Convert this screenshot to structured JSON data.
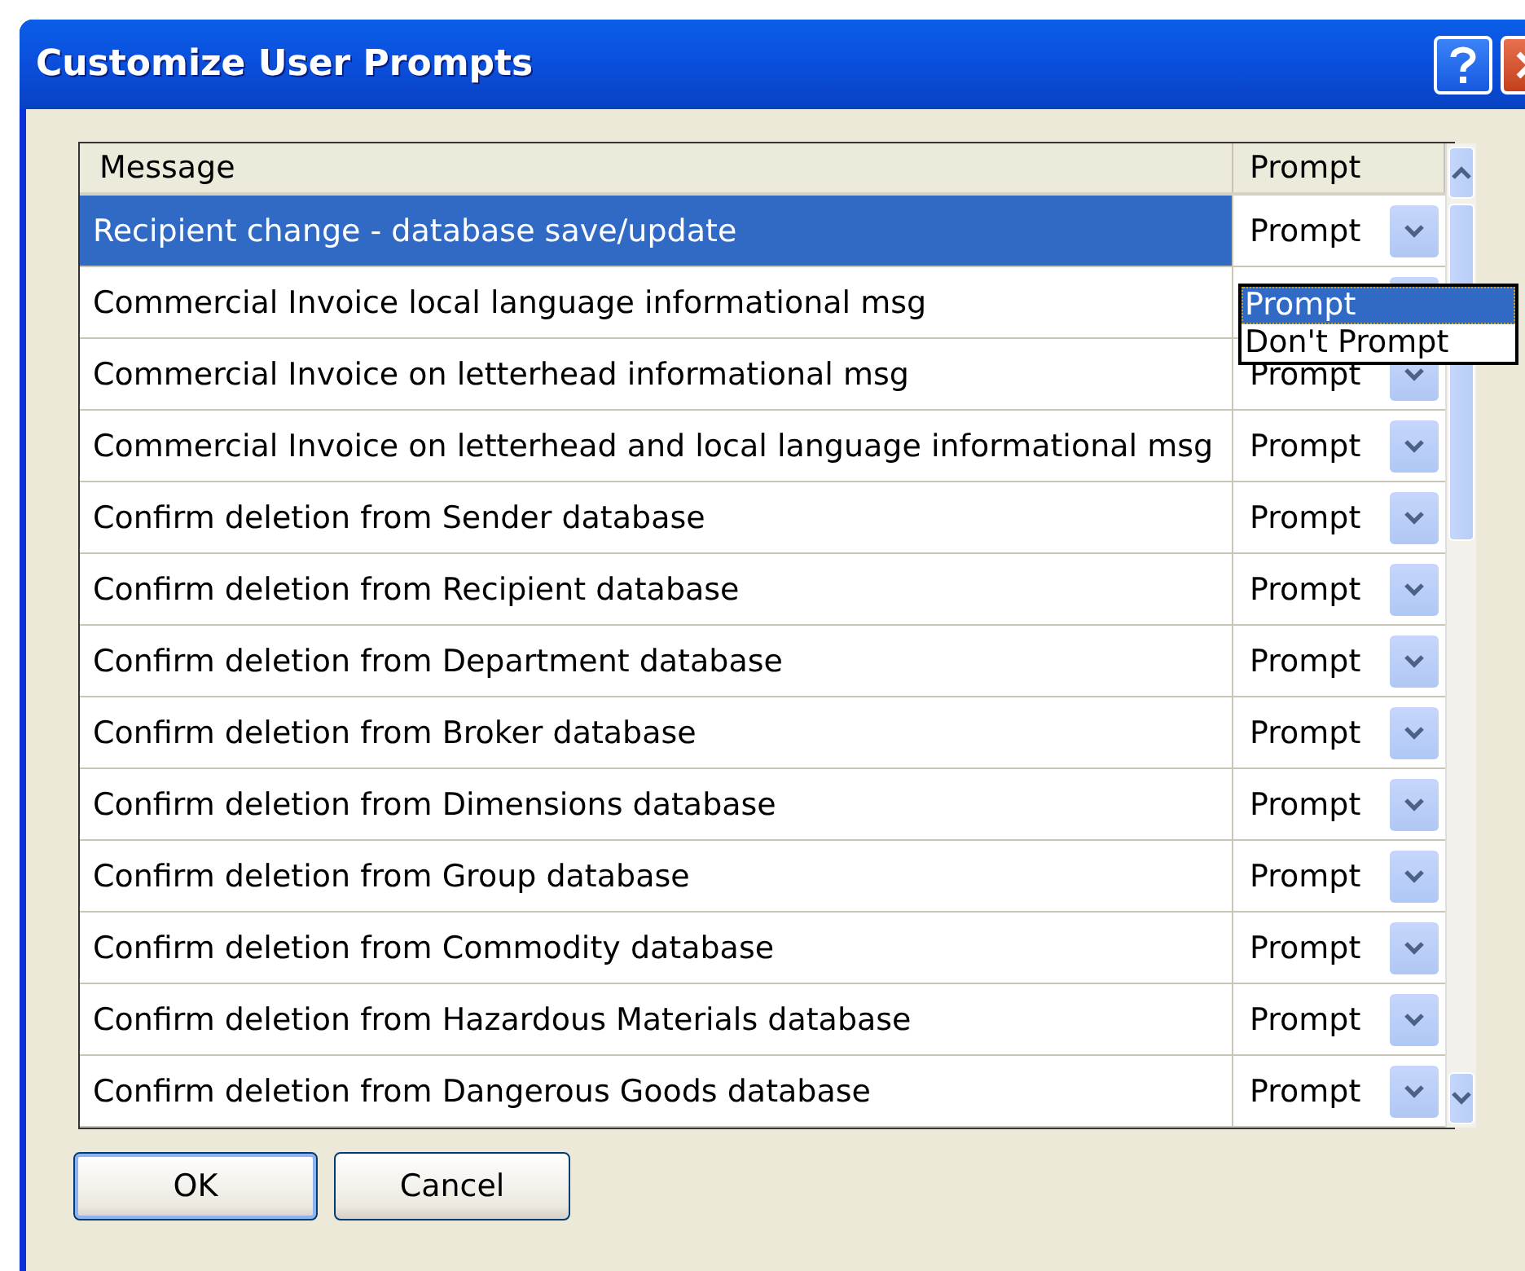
{
  "window": {
    "title": "Customize User Prompts"
  },
  "table": {
    "columns": [
      "Message",
      "Prompt"
    ],
    "rows": [
      {
        "message": "Recipient change - database save/update",
        "prompt": "Prompt",
        "selected": true
      },
      {
        "message": "Commercial Invoice local language informational msg",
        "selected": false
      },
      {
        "message": "Commercial Invoice on letterhead informational msg",
        "prompt": "Prompt",
        "selected": false
      },
      {
        "message": "Commercial Invoice on letterhead and local language informational msg",
        "prompt": "Prompt",
        "selected": false
      },
      {
        "message": "Confirm deletion from Sender database",
        "prompt": "Prompt",
        "selected": false
      },
      {
        "message": "Confirm deletion from Recipient database",
        "prompt": "Prompt",
        "selected": false
      },
      {
        "message": "Confirm deletion from Department database",
        "prompt": "Prompt",
        "selected": false
      },
      {
        "message": "Confirm deletion from Broker database",
        "prompt": "Prompt",
        "selected": false
      },
      {
        "message": "Confirm deletion from Dimensions database",
        "prompt": "Prompt",
        "selected": false
      },
      {
        "message": "Confirm deletion from Group database",
        "prompt": "Prompt",
        "selected": false
      },
      {
        "message": "Confirm deletion from Commodity database",
        "prompt": "Prompt",
        "selected": false
      },
      {
        "message": "Confirm deletion from Hazardous Materials database",
        "prompt": "Prompt",
        "selected": false
      },
      {
        "message": "Confirm deletion from Dangerous Goods database",
        "prompt": "Prompt",
        "selected": false
      }
    ]
  },
  "dropdown": {
    "options": [
      {
        "label": "Prompt",
        "selected": true
      },
      {
        "label": "Don't Prompt",
        "selected": false
      }
    ]
  },
  "buttons": [
    "OK",
    "Cancel"
  ]
}
